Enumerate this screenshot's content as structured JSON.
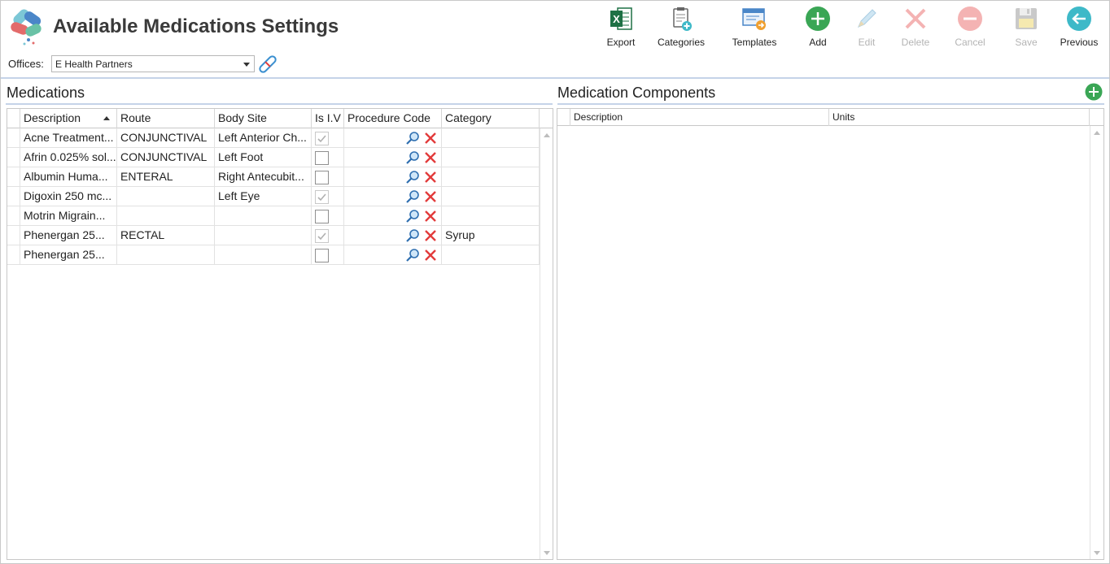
{
  "app": {
    "title": "Available Medications Settings",
    "offices_label": "Offices:",
    "office_selected": "E Health Partners"
  },
  "toolbar": {
    "export": "Export",
    "categories": "Categories",
    "templates": "Templates",
    "add": "Add",
    "edit": "Edit",
    "delete": "Delete",
    "cancel": "Cancel",
    "save": "Save",
    "previous": "Previous"
  },
  "medications": {
    "title": "Medications",
    "columns": [
      "Description",
      "Route",
      "Body Site",
      "Is I.V",
      "Procedure Code",
      "Category"
    ],
    "rows": [
      {
        "description": "Acne Treatment...",
        "route": "CONJUNCTIVAL",
        "body_site": "Left Anterior Ch...",
        "is_iv": true,
        "category": ""
      },
      {
        "description": "Afrin 0.025% sol...",
        "route": "CONJUNCTIVAL",
        "body_site": "Left Foot",
        "is_iv": false,
        "category": ""
      },
      {
        "description": "Albumin Huma...",
        "route": "ENTERAL",
        "body_site": "Right Antecubit...",
        "is_iv": false,
        "category": ""
      },
      {
        "description": "Digoxin 250 mc...",
        "route": "",
        "body_site": "Left Eye",
        "is_iv": true,
        "category": ""
      },
      {
        "description": "Motrin Migrain...",
        "route": "",
        "body_site": "",
        "is_iv": false,
        "category": ""
      },
      {
        "description": "Phenergan 25...",
        "route": "RECTAL",
        "body_site": "",
        "is_iv": true,
        "category": "Syrup"
      },
      {
        "description": "Phenergan 25...",
        "route": "",
        "body_site": "",
        "is_iv": false,
        "category": ""
      }
    ]
  },
  "components": {
    "title": "Medication Components",
    "columns": [
      "Description",
      "Units"
    ]
  },
  "colors": {
    "accent_rule": "#c5d3e8",
    "add_green": "#3aa655",
    "delete_red": "#e23b3b",
    "previous_teal": "#3eb9c8",
    "disabled": "#b4b4b4"
  }
}
